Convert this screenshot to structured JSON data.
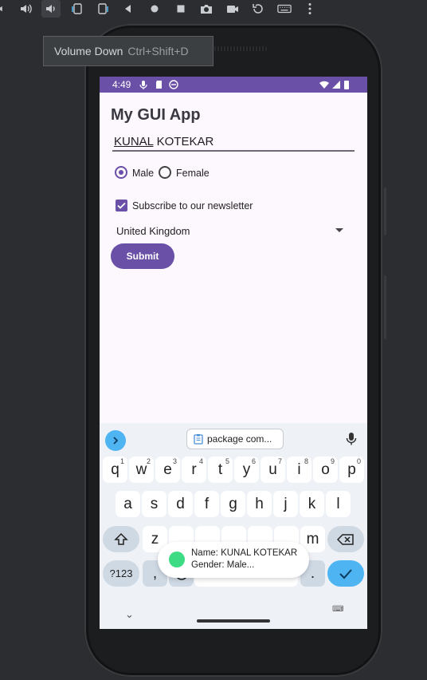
{
  "emulator": {
    "tooltip_label": "Volume Down",
    "tooltip_shortcut": "Ctrl+Shift+D",
    "toolbar_icons": [
      "volume-up-icon",
      "volume-down-icon",
      "rotate-left-icon",
      "rotate-right-icon",
      "back-icon",
      "home-icon",
      "overview-icon",
      "camera-icon",
      "video-icon",
      "reset-icon",
      "keyboard-icon",
      "more-icon"
    ]
  },
  "status_bar": {
    "time": "4:49"
  },
  "app": {
    "title": "My GUI App",
    "name_first": "KUNAL",
    "name_last": " KOTEKAR",
    "gender_options": [
      "Male",
      "Female"
    ],
    "gender_selected": "Male",
    "newsletter_label": "Subscribe to our newsletter",
    "newsletter_checked": true,
    "country": "United Kingdom",
    "submit_label": "Submit"
  },
  "keyboard": {
    "clipboard_chip": "package com...",
    "row1": [
      {
        "k": "q",
        "s": "1"
      },
      {
        "k": "w",
        "s": "2"
      },
      {
        "k": "e",
        "s": "3"
      },
      {
        "k": "r",
        "s": "4"
      },
      {
        "k": "t",
        "s": "5"
      },
      {
        "k": "y",
        "s": "6"
      },
      {
        "k": "u",
        "s": "7"
      },
      {
        "k": "i",
        "s": "8"
      },
      {
        "k": "o",
        "s": "9"
      },
      {
        "k": "p",
        "s": "0"
      }
    ],
    "row2": [
      "a",
      "s",
      "d",
      "f",
      "g",
      "h",
      "j",
      "k",
      "l"
    ],
    "row3_letters": [
      "z",
      "m"
    ],
    "symbols_key": "?123",
    "comma_key": ",",
    "period_key": "."
  },
  "toast": {
    "line1": "Name: KUNAL KOTEKAR",
    "line2": "Gender: Male..."
  },
  "colors": {
    "accent": "#6a50a7",
    "keyboard_accent": "#4fb4f2"
  }
}
